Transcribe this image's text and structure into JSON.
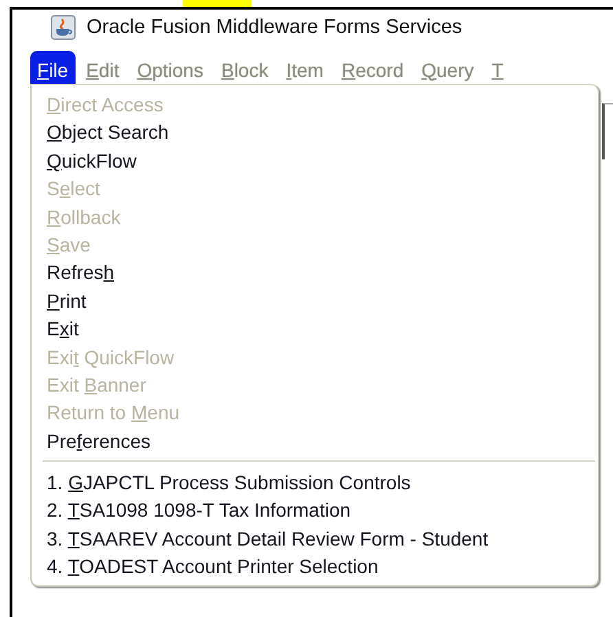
{
  "window": {
    "title": "Oracle Fusion Middleware Forms Services"
  },
  "menubar": [
    {
      "label": [
        {
          "text": "F",
          "underline": true
        },
        {
          "text": "ile",
          "underline": false
        }
      ],
      "selected": true
    },
    {
      "label": [
        {
          "text": "E",
          "underline": true
        },
        {
          "text": "dit",
          "underline": false
        }
      ],
      "selected": false
    },
    {
      "label": [
        {
          "text": "O",
          "underline": true
        },
        {
          "text": "ptions",
          "underline": false
        }
      ],
      "selected": false
    },
    {
      "label": [
        {
          "text": "B",
          "underline": true
        },
        {
          "text": "lock",
          "underline": false
        }
      ],
      "selected": false
    },
    {
      "label": [
        {
          "text": "I",
          "underline": true
        },
        {
          "text": "tem",
          "underline": false
        }
      ],
      "selected": false
    },
    {
      "label": [
        {
          "text": "R",
          "underline": true
        },
        {
          "text": "ecord",
          "underline": false
        }
      ],
      "selected": false
    },
    {
      "label": [
        {
          "text": "Q",
          "underline": true
        },
        {
          "text": "uery",
          "underline": false
        }
      ],
      "selected": false
    },
    {
      "label": [
        {
          "text": "T",
          "underline": true
        }
      ],
      "selected": false
    }
  ],
  "menu": [
    {
      "kind": "item",
      "disabled": true,
      "label": [
        {
          "text": "D",
          "underline": true
        },
        {
          "text": "irect Access",
          "underline": false
        }
      ]
    },
    {
      "kind": "item",
      "disabled": false,
      "label": [
        {
          "text": "O",
          "underline": true
        },
        {
          "text": "bject Search",
          "underline": false
        }
      ]
    },
    {
      "kind": "item",
      "disabled": false,
      "label": [
        {
          "text": "Q",
          "underline": true
        },
        {
          "text": "uickFlow",
          "underline": false
        }
      ]
    },
    {
      "kind": "item",
      "disabled": true,
      "label": [
        {
          "text": "S",
          "underline": false
        },
        {
          "text": "e",
          "underline": true
        },
        {
          "text": "lect",
          "underline": false
        }
      ]
    },
    {
      "kind": "item",
      "disabled": true,
      "label": [
        {
          "text": "R",
          "underline": true
        },
        {
          "text": "ollback",
          "underline": false
        }
      ]
    },
    {
      "kind": "item",
      "disabled": true,
      "label": [
        {
          "text": "S",
          "underline": true
        },
        {
          "text": "ave",
          "underline": false
        }
      ]
    },
    {
      "kind": "item",
      "disabled": false,
      "label": [
        {
          "text": "Refres",
          "underline": false
        },
        {
          "text": "h",
          "underline": true
        }
      ]
    },
    {
      "kind": "item",
      "disabled": false,
      "label": [
        {
          "text": "P",
          "underline": true
        },
        {
          "text": "rint",
          "underline": false
        }
      ]
    },
    {
      "kind": "item",
      "disabled": false,
      "label": [
        {
          "text": "E",
          "underline": false
        },
        {
          "text": "x",
          "underline": true
        },
        {
          "text": "it",
          "underline": false
        }
      ]
    },
    {
      "kind": "item",
      "disabled": true,
      "label": [
        {
          "text": "Exi",
          "underline": false
        },
        {
          "text": "t",
          "underline": true
        },
        {
          "text": " QuickFlow",
          "underline": false
        }
      ]
    },
    {
      "kind": "item",
      "disabled": true,
      "label": [
        {
          "text": "Exit ",
          "underline": false
        },
        {
          "text": "B",
          "underline": true
        },
        {
          "text": "anner",
          "underline": false
        }
      ]
    },
    {
      "kind": "item",
      "disabled": true,
      "label": [
        {
          "text": "Return to ",
          "underline": false
        },
        {
          "text": "M",
          "underline": true
        },
        {
          "text": "enu",
          "underline": false
        }
      ]
    },
    {
      "kind": "item",
      "disabled": false,
      "label": [
        {
          "text": "Pre",
          "underline": false
        },
        {
          "text": "f",
          "underline": true
        },
        {
          "text": "erences",
          "underline": false
        }
      ]
    },
    {
      "kind": "separator"
    },
    {
      "kind": "item",
      "disabled": false,
      "label": [
        {
          "text": "1. ",
          "underline": false
        },
        {
          "text": "G",
          "underline": true
        },
        {
          "text": "JAPCTL Process Submission Controls",
          "underline": false
        }
      ]
    },
    {
      "kind": "item",
      "disabled": false,
      "label": [
        {
          "text": "2. ",
          "underline": false
        },
        {
          "text": "T",
          "underline": true
        },
        {
          "text": "SA1098 1098-T Tax Information",
          "underline": false
        }
      ]
    },
    {
      "kind": "item",
      "disabled": false,
      "label": [
        {
          "text": "3. ",
          "underline": false
        },
        {
          "text": "T",
          "underline": true
        },
        {
          "text": "SAAREV Account Detail Review Form - Student",
          "underline": false
        }
      ]
    },
    {
      "kind": "item",
      "disabled": false,
      "label": [
        {
          "text": "4. ",
          "underline": false
        },
        {
          "text": "T",
          "underline": true
        },
        {
          "text": "OADEST Account Printer Selection",
          "underline": false
        }
      ]
    }
  ]
}
